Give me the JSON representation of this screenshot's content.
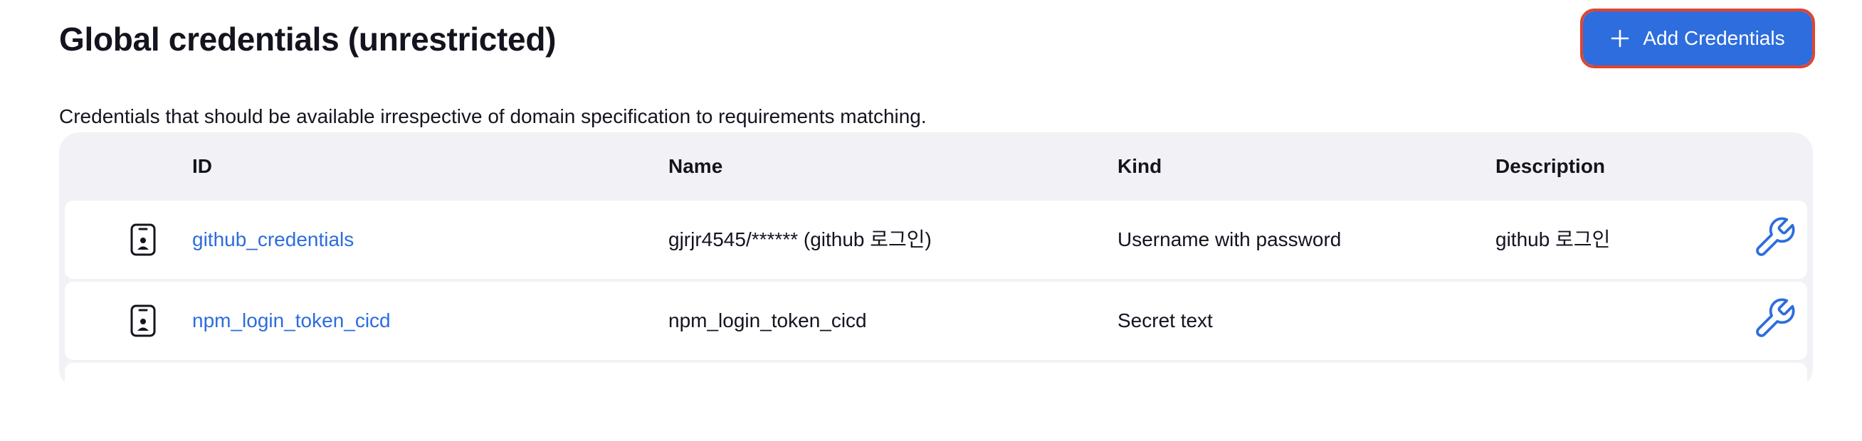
{
  "page": {
    "title": "Global credentials (unrestricted)",
    "description": "Credentials that should be available irrespective of domain specification to requirements matching.",
    "add_button_label": "Add Credentials"
  },
  "table": {
    "columns": [
      "ID",
      "Name",
      "Kind",
      "Description"
    ],
    "rows": [
      {
        "icon": "credential-device-icon",
        "id": "github_credentials",
        "name": "gjrjr4545/****** (github 로그인)",
        "kind": "Username with password",
        "description": "github 로그인",
        "action_icon": "wrench-icon"
      },
      {
        "icon": "credential-device-icon",
        "id": "npm_login_token_cicd",
        "name": "npm_login_token_cicd",
        "kind": "Secret text",
        "description": "",
        "action_icon": "wrench-icon"
      }
    ]
  },
  "colors": {
    "accent": "#2d6ddd",
    "highlight_border": "#e0442f",
    "table_background": "#f2f2f6",
    "text": "#14141f"
  }
}
